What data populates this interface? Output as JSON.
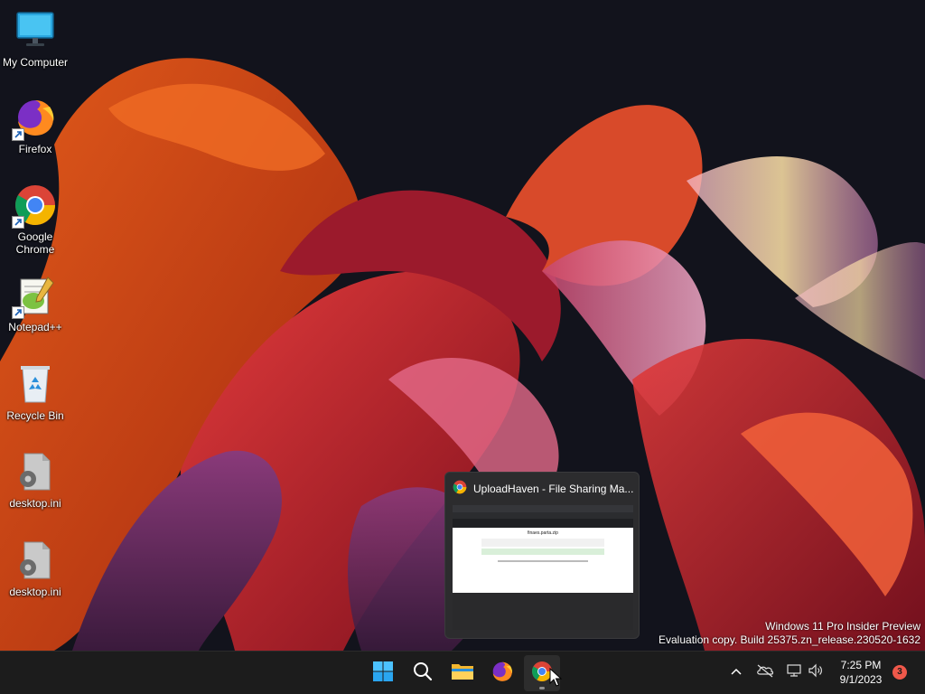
{
  "desktop": {
    "icons": [
      {
        "label": "My Computer",
        "icon": "monitor-icon"
      },
      {
        "label": "Firefox",
        "icon": "firefox-icon"
      },
      {
        "label": "Google Chrome",
        "icon": "chrome-icon"
      },
      {
        "label": "Notepad++",
        "icon": "notepadpp-icon"
      },
      {
        "label": "Recycle Bin",
        "icon": "recycle-bin-icon"
      },
      {
        "label": "desktop.ini",
        "icon": "settings-file-icon"
      },
      {
        "label": "desktop.ini",
        "icon": "settings-file-icon"
      }
    ]
  },
  "watermark": {
    "line1": "Windows 11 Pro Insider Preview",
    "line2": "Evaluation copy. Build 25375.zn_release.230520-1632"
  },
  "preview": {
    "title": "UploadHaven - File Sharing Ma...",
    "icon": "chrome-icon",
    "page_heading": "finaes.parta.zip"
  },
  "taskbar": {
    "apps": [
      "windows-start-icon",
      "search-icon",
      "file-explorer-icon",
      "firefox-icon",
      "chrome-icon"
    ],
    "active_app": "chrome-icon",
    "tray": [
      "chevron-up-icon",
      "onedrive-icon",
      "network-icon",
      "volume-icon"
    ],
    "time": "7:25 PM",
    "date": "9/1/2023",
    "notification_count": "3"
  },
  "colors": {
    "taskbar_bg": "#1c1c1c",
    "preview_bg": "#2c2c2e",
    "notification_badge": "#f0584a"
  }
}
